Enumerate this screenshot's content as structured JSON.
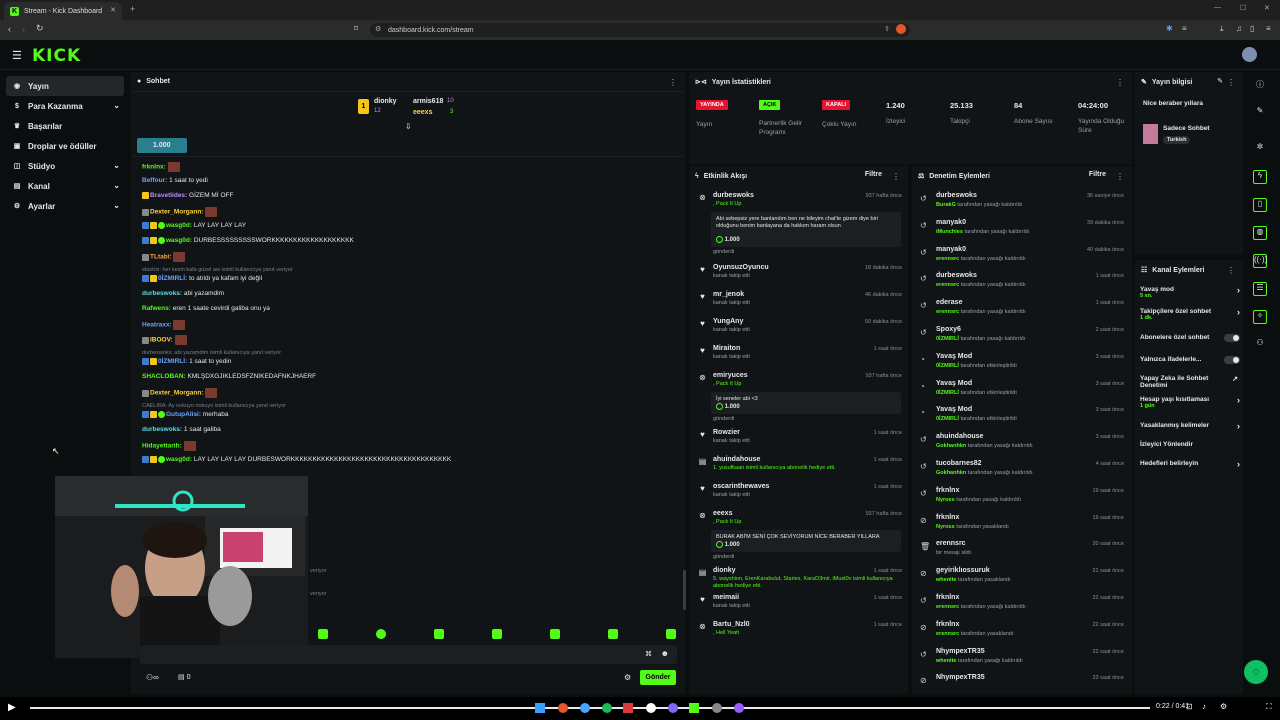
{
  "browser": {
    "tab_title": "Stream - Kick Dashboard",
    "url": "dashboard.kick.com/stream"
  },
  "header": {
    "logo": "KICK"
  },
  "nav": [
    {
      "label": "Yayın",
      "icon": "broadcast-icon",
      "active": true
    },
    {
      "label": "Para Kazanma",
      "icon": "dollar-icon",
      "chevron": true
    },
    {
      "label": "Başarılar",
      "icon": "trophy-icon"
    },
    {
      "label": "Droplar ve ödüller",
      "icon": "gift-icon"
    },
    {
      "label": "Stüdyo",
      "icon": "studio-icon",
      "chevron": true
    },
    {
      "label": "Kanal",
      "icon": "channel-icon",
      "chevron": true
    },
    {
      "label": "Ayarlar",
      "icon": "gear-icon",
      "chevron": true
    }
  ],
  "chat": {
    "title": "Sohbet",
    "leaders": [
      {
        "name": "dionky",
        "count": "12"
      },
      {
        "name": "armis618",
        "count": "10"
      },
      {
        "name": "eeexs",
        "count": "3"
      }
    ],
    "pinned_amount": "1.000",
    "lines": [
      {
        "user": "frknlnx:",
        "text": "",
        "color": "green"
      },
      {
        "user": "Beffour:",
        "text": "1 saat to yedi",
        "color": "blue"
      },
      {
        "user": "Bravetiides:",
        "text": "GİZEM Mİ OFF",
        "color": "purple"
      },
      {
        "user": "Dexter_Morgann:",
        "text": "",
        "color": "yellow"
      },
      {
        "user": "wasg0d:",
        "text": "LAY LAY LAY LAY",
        "color": "green"
      },
      {
        "user": "wasg0d:",
        "text": "DURBESSSSSSSSSWORKKKKKKKKKKKKKKKKKKK",
        "color": "green"
      },
      {
        "user": "TLtabi:",
        "text": "",
        "color": "orange"
      },
      {
        "sys": "elastrix: her kesin kafa güzel aw isimli kullanıcıya yanıt veriyor"
      },
      {
        "user": "0İZMIRLİ:",
        "text": "to atıldı ya kafam iyi değil",
        "color": "blue"
      },
      {
        "user": "durbeswoks:",
        "text": "abi yazamdim",
        "color": "cyan"
      },
      {
        "user": "Rafwens:",
        "text": "eren 1 saate cevirdi galiba onu ya",
        "color": "green"
      },
      {
        "user": "Heatraxx:",
        "text": "",
        "color": "blue"
      },
      {
        "user": "IBOOV:",
        "text": "",
        "color": "yellow"
      },
      {
        "sys": "durbeswoks: abi yazamdim isimli kullanıcıya yanıt veriyor"
      },
      {
        "user": "0İZMIRLİ:",
        "text": "1 saat to yedin",
        "color": "blue"
      },
      {
        "user": "SHACLOBAN:",
        "text": "KMLŞDXGJIKLEDSFZNIKEDAFNKJHAERF",
        "color": "green"
      },
      {
        "user": "Dexter_Morgann:",
        "text": "",
        "color": "yellow"
      },
      {
        "sys": "CAELIRA: Ay nokuyo nokuyo isimli kullanıcıya yanıt veriyor"
      },
      {
        "user": "GutupAlisi:",
        "text": "merhaba",
        "color": "blue"
      },
      {
        "user": "durbeswoks:",
        "text": "1 saat galiba",
        "color": "cyan"
      },
      {
        "user": "Hidayettarih:",
        "text": "",
        "color": "green"
      },
      {
        "user": "wasg0d:",
        "text": "LAY LAY LAY LAY DURBESWORKKKKKKKKKKKKKKKKKKKKKKKKKKKKKKKKKKKKK",
        "color": "green"
      }
    ],
    "faded_replies": [
      "veriyor",
      "veriyor"
    ],
    "viewer_icon_count": "0",
    "send_label": "Gönder"
  },
  "stats": {
    "title": "Yayın İstatistikleri",
    "badges": [
      {
        "label": "YAYINDA",
        "caption": "Yayın",
        "color": "#e8132f"
      },
      {
        "label": "AÇIK",
        "caption": "Partnerlik Gelir Programı",
        "color": "#53fc18"
      },
      {
        "label": "KAPALI",
        "caption": "Çoklu Yayın",
        "color": "#e8132f"
      }
    ],
    "values": [
      {
        "value": "1.240",
        "caption": "İzleyici"
      },
      {
        "value": "25.133",
        "caption": "Takipçi"
      },
      {
        "value": "84",
        "caption": "Abone Sayısı"
      },
      {
        "value": "04:24:00",
        "caption": "Yayında Olduğu Süre"
      }
    ]
  },
  "activity": {
    "title": "Etkinlik Akışı",
    "filter": "Filtre",
    "events": [
      {
        "icon": "kick-icon",
        "name": "durbeswoks",
        "sub": ", Pack It Up",
        "time": "937 hafta önce",
        "msg": "Abi sebepsiz yere banlandım ben ne bileyim chat'te gizem diye biri olduğunu benim banlayana da hakkım haram olsun",
        "amount": "1.000",
        "footer": "gönderdi"
      },
      {
        "icon": "heart-icon",
        "name": "OyunsuzOyuncu",
        "sub": "kanalı takip etti",
        "time": "18 dakika önce"
      },
      {
        "icon": "heart-icon",
        "name": "mr_jenok",
        "sub": "kanalı takip etti",
        "time": "46 dakika önce"
      },
      {
        "icon": "heart-icon",
        "name": "YungAny",
        "sub": "kanalı takip etti",
        "time": "50 dakika önce"
      },
      {
        "icon": "heart-icon",
        "name": "Miraiton",
        "sub": "kanalı takip etti",
        "time": "1 saat önce"
      },
      {
        "icon": "kick-icon",
        "name": "emiryuces",
        "sub": ", Pack It Up",
        "time": "937 hafta önce",
        "msg": "İyi seneler abi <3",
        "amount": "1.000",
        "footer": "gönderdi"
      },
      {
        "icon": "heart-icon",
        "name": "Rowzier",
        "sub": "kanalı takip etti",
        "time": "1 saat önce"
      },
      {
        "icon": "sub-icon",
        "name": "ahuindahouse",
        "sub": "1. yusufkaan isimli kullanıcıya abonelik hediye etti.",
        "time": "1 saat önce"
      },
      {
        "icon": "heart-icon",
        "name": "oscarinthewaves",
        "sub": "kanalı takip etti",
        "time": "1 saat önce"
      },
      {
        "icon": "kick-icon",
        "name": "eeexs",
        "sub": ", Pack It Up",
        "time": "937 hafta önce",
        "msg": "BURAK ABİ'M SENİ ÇOK SEVİYORUM NİCE BERABER YILLARA",
        "amount": "1.000",
        "footer": "gönderdi"
      },
      {
        "icon": "sub-icon",
        "name": "dionky",
        "sub": "5. wayshion, ErenKarabulut, Stariex, KaraD3mir, iMust0v isimli kullanıcıya abonelik hediye etti.",
        "time": "1 saat önce"
      },
      {
        "icon": "heart-icon",
        "name": "meimaii",
        "sub": "kanalı takip etti",
        "time": "1 saat önce"
      },
      {
        "icon": "kick-icon",
        "name": "Bartu_Nzl0",
        "sub": ", Hell Yeah",
        "time": "1 saat önce"
      }
    ]
  },
  "moderation": {
    "title": "Denetim Eylemleri",
    "filter": "Filtre",
    "actions": [
      {
        "icon": "undo-icon",
        "name": "durbeswoks",
        "by": "BurakG",
        "text": "tarafından yasağı kaldırıldı",
        "time": "36 saniye önce"
      },
      {
        "icon": "undo-icon",
        "name": "manyak0",
        "by": "iMunchies",
        "text": "tarafından yasağı kaldırıldı",
        "time": "39 dakika önce"
      },
      {
        "icon": "undo-icon",
        "name": "manyak0",
        "by": "erennsrc",
        "text": "tarafından yasağı kaldırıldı",
        "time": "40 dakika önce"
      },
      {
        "icon": "undo-icon",
        "name": "durbeswoks",
        "by": "erennsrc",
        "text": "tarafından yasağı kaldırıldı",
        "time": "1 saat önce"
      },
      {
        "icon": "undo-icon",
        "name": "ederase",
        "by": "erennsrc",
        "text": "tarafından yasağı kaldırıldı",
        "time": "1 saat önce"
      },
      {
        "icon": "undo-icon",
        "name": "Spoxy6",
        "by": "0İZMIRLİ",
        "text": "tarafından yasağı kaldırıldı",
        "time": "2 saat önce"
      },
      {
        "icon": "slow-icon",
        "name": "Yavaş Mod",
        "by": "0İZMIRLİ",
        "text": "tarafından etkinleştirildi",
        "time": "3 saat önce"
      },
      {
        "icon": "slow-icon",
        "name": "Yavaş Mod",
        "by": "0İZMIRLİ",
        "text": "tarafından etkinleştirildi",
        "time": "3 saat önce"
      },
      {
        "icon": "slow-icon",
        "name": "Yavaş Mod",
        "by": "0İZMIRLİ",
        "text": "tarafından etkinleştirildi",
        "time": "3 saat önce"
      },
      {
        "icon": "undo-icon",
        "name": "ahuindahouse",
        "by": "Gokhanhkn",
        "text": "tarafından yasağı kaldırıldı",
        "time": "3 saat önce"
      },
      {
        "icon": "undo-icon",
        "name": "tucobarnes82",
        "by": "Gokhanhkn",
        "text": "tarafından yasağı kaldırıldı",
        "time": "4 saat önce"
      },
      {
        "icon": "undo-icon",
        "name": "frknlnx",
        "by": "Nyross",
        "text": "tarafından yasağı kaldırıldı",
        "time": "19 saat önce"
      },
      {
        "icon": "ban-icon",
        "name": "frknlnx",
        "by": "Nyross",
        "text": "tarafından yasaklandı",
        "time": "19 saat önce"
      },
      {
        "icon": "trash-icon",
        "name": "erennsrc",
        "by": "",
        "text": "bir mesajı sildi",
        "time": "20 saat önce"
      },
      {
        "icon": "ban-icon",
        "name": "geyiriklıossuruk",
        "by": "whenite",
        "text": "tarafından yasaklandı",
        "time": "21 saat önce"
      },
      {
        "icon": "undo-icon",
        "name": "frknlnx",
        "by": "erennsrc",
        "text": "tarafından yasağı kaldırıldı",
        "time": "22 saat önce"
      },
      {
        "icon": "ban-icon",
        "name": "frknlnx",
        "by": "erennsrc",
        "text": "tarafından yasaklandı",
        "time": "22 saat önce"
      },
      {
        "icon": "undo-icon",
        "name": "NhympexTR35",
        "by": "whenite",
        "text": "tarafından yasağı kaldırıldı",
        "time": "22 saat önce"
      },
      {
        "icon": "ban-icon",
        "name": "NhympexTR35",
        "by": "",
        "text": "",
        "time": "23 saat önce"
      }
    ]
  },
  "stream_info": {
    "title": "Yayın bilgisi",
    "stream_title": "Nice beraber yıllara",
    "category": "Sadece Sohbet",
    "language": "Turkish"
  },
  "channel_actions": {
    "title": "Kanal Eylemleri",
    "items": [
      {
        "label": "Yavaş mod",
        "sub": "5 sn.",
        "control": "chevron"
      },
      {
        "label": "Takipçilere özel sohbet",
        "sub": "1 dk.",
        "control": "chevron"
      },
      {
        "label": "Abonelere özel sohbet",
        "sub": "",
        "control": "toggle"
      },
      {
        "label": "Yalnızca ifadelerle...",
        "sub": "",
        "control": "toggle"
      },
      {
        "label": "Yapay Zeka ile Sohbet Denetimi",
        "sub": "",
        "control": "external"
      },
      {
        "label": "Hesap yaşı kısıtlaması",
        "sub": "1 gün",
        "control": "chevron"
      },
      {
        "label": "Yasaklanmış kelimeler",
        "sub": "",
        "control": "chevron"
      },
      {
        "label": "İzleyici Yönlendir",
        "sub": "",
        "control": "none"
      },
      {
        "label": "Hedefleri belirleyin",
        "sub": "",
        "control": "chevron"
      }
    ]
  },
  "player": {
    "time": "0:22 / 0:41"
  },
  "colors": {
    "kick_green": "#53fc18",
    "live_red": "#e8132f",
    "panel_bg": "#111416",
    "page_bg": "#0b0e0f"
  }
}
